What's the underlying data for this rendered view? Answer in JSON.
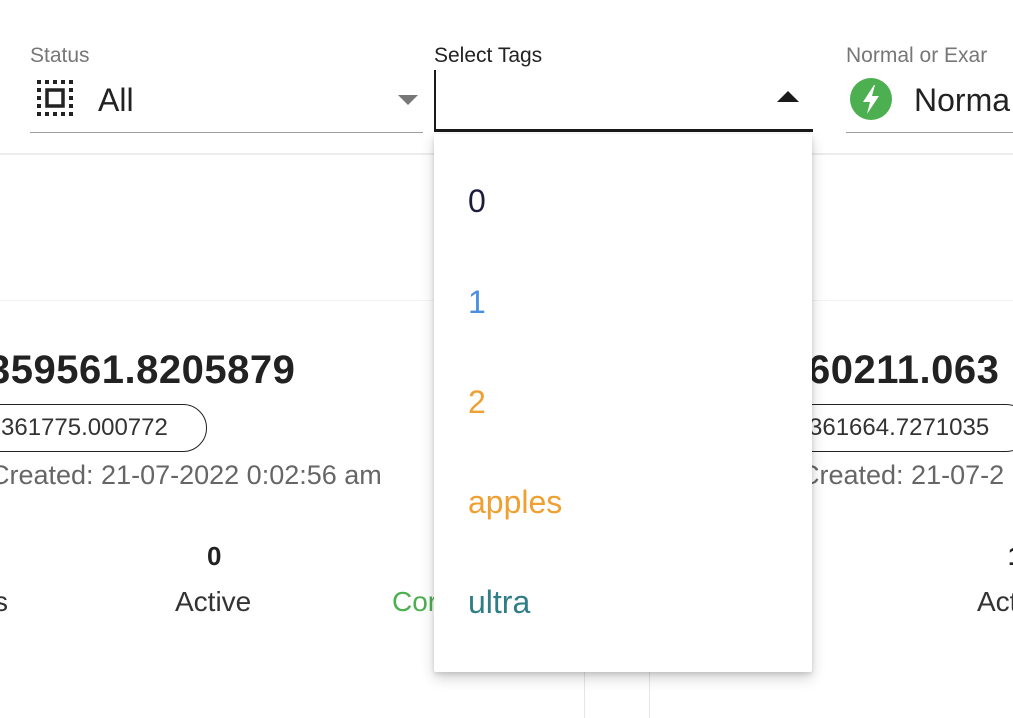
{
  "filters": {
    "status": {
      "label": "Status",
      "value": "All",
      "icon": "select-all-icon"
    },
    "tags": {
      "label": "Select Tags",
      "value": "",
      "open": true
    },
    "mode": {
      "label": "Normal or Exar",
      "value": "Norma",
      "icon": "bolt-icon",
      "icon_color": "#4caf50"
    }
  },
  "tag_options": [
    {
      "label": "0",
      "color": "#1c1c3c"
    },
    {
      "label": "1",
      "color": "#4a8fe0"
    },
    {
      "label": "2",
      "color": "#f0a030"
    },
    {
      "label": "apples",
      "color": "#f0a030"
    },
    {
      "label": "ultra",
      "color": "#2f7d87"
    }
  ],
  "cards": [
    {
      "title": "359561.8205879",
      "chip": "361775.000772",
      "created": "Created: 21-07-2022 0:02:56 am",
      "stat_left_label": "s",
      "active_count": "0",
      "active_label": "Active",
      "completed_label": "Cor"
    },
    {
      "title": "60211.063",
      "chip": "361664.7271035",
      "created": "Created: 21-07-2",
      "active_count": "1",
      "active_label": "Act"
    }
  ],
  "colors": {
    "accent_green": "#4caf50",
    "text_dark": "#222222",
    "text_muted": "#777777"
  }
}
